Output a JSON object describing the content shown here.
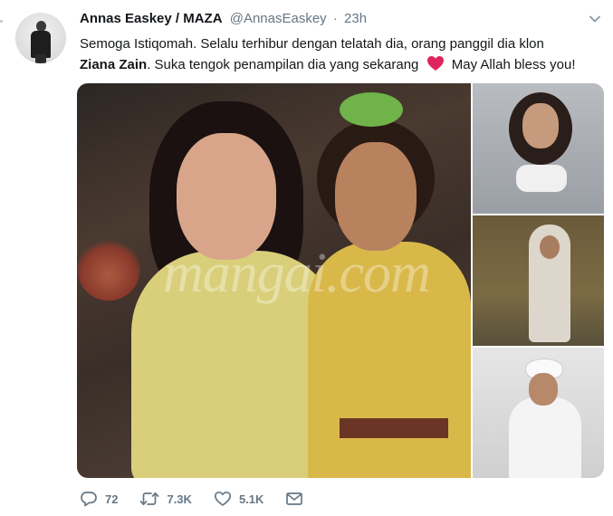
{
  "tweet": {
    "display_name": "Annas Easkey / MAZA",
    "handle": "@AnnasEaskey",
    "separator": "·",
    "timestamp": "23h",
    "text_line1": "Semoga Istiqomah. Selalu terhibur dengan telatah dia, orang panggil dia klon",
    "text_bold": "Ziana Zain",
    "text_line2_mid": ". Suka tengok penampilan dia yang sekarang",
    "text_line2_end": "May Allah bless you!",
    "heart_color": "#e0245e"
  },
  "media": {
    "watermark": "mangai.com"
  },
  "actions": {
    "reply_count": "72",
    "retweet_count": "7.3K",
    "like_count": "5.1K"
  },
  "icons": [
    "avatar",
    "chevron-down-icon",
    "heart-emoji-icon",
    "reply-icon",
    "retweet-icon",
    "like-icon",
    "direct-message-icon"
  ]
}
